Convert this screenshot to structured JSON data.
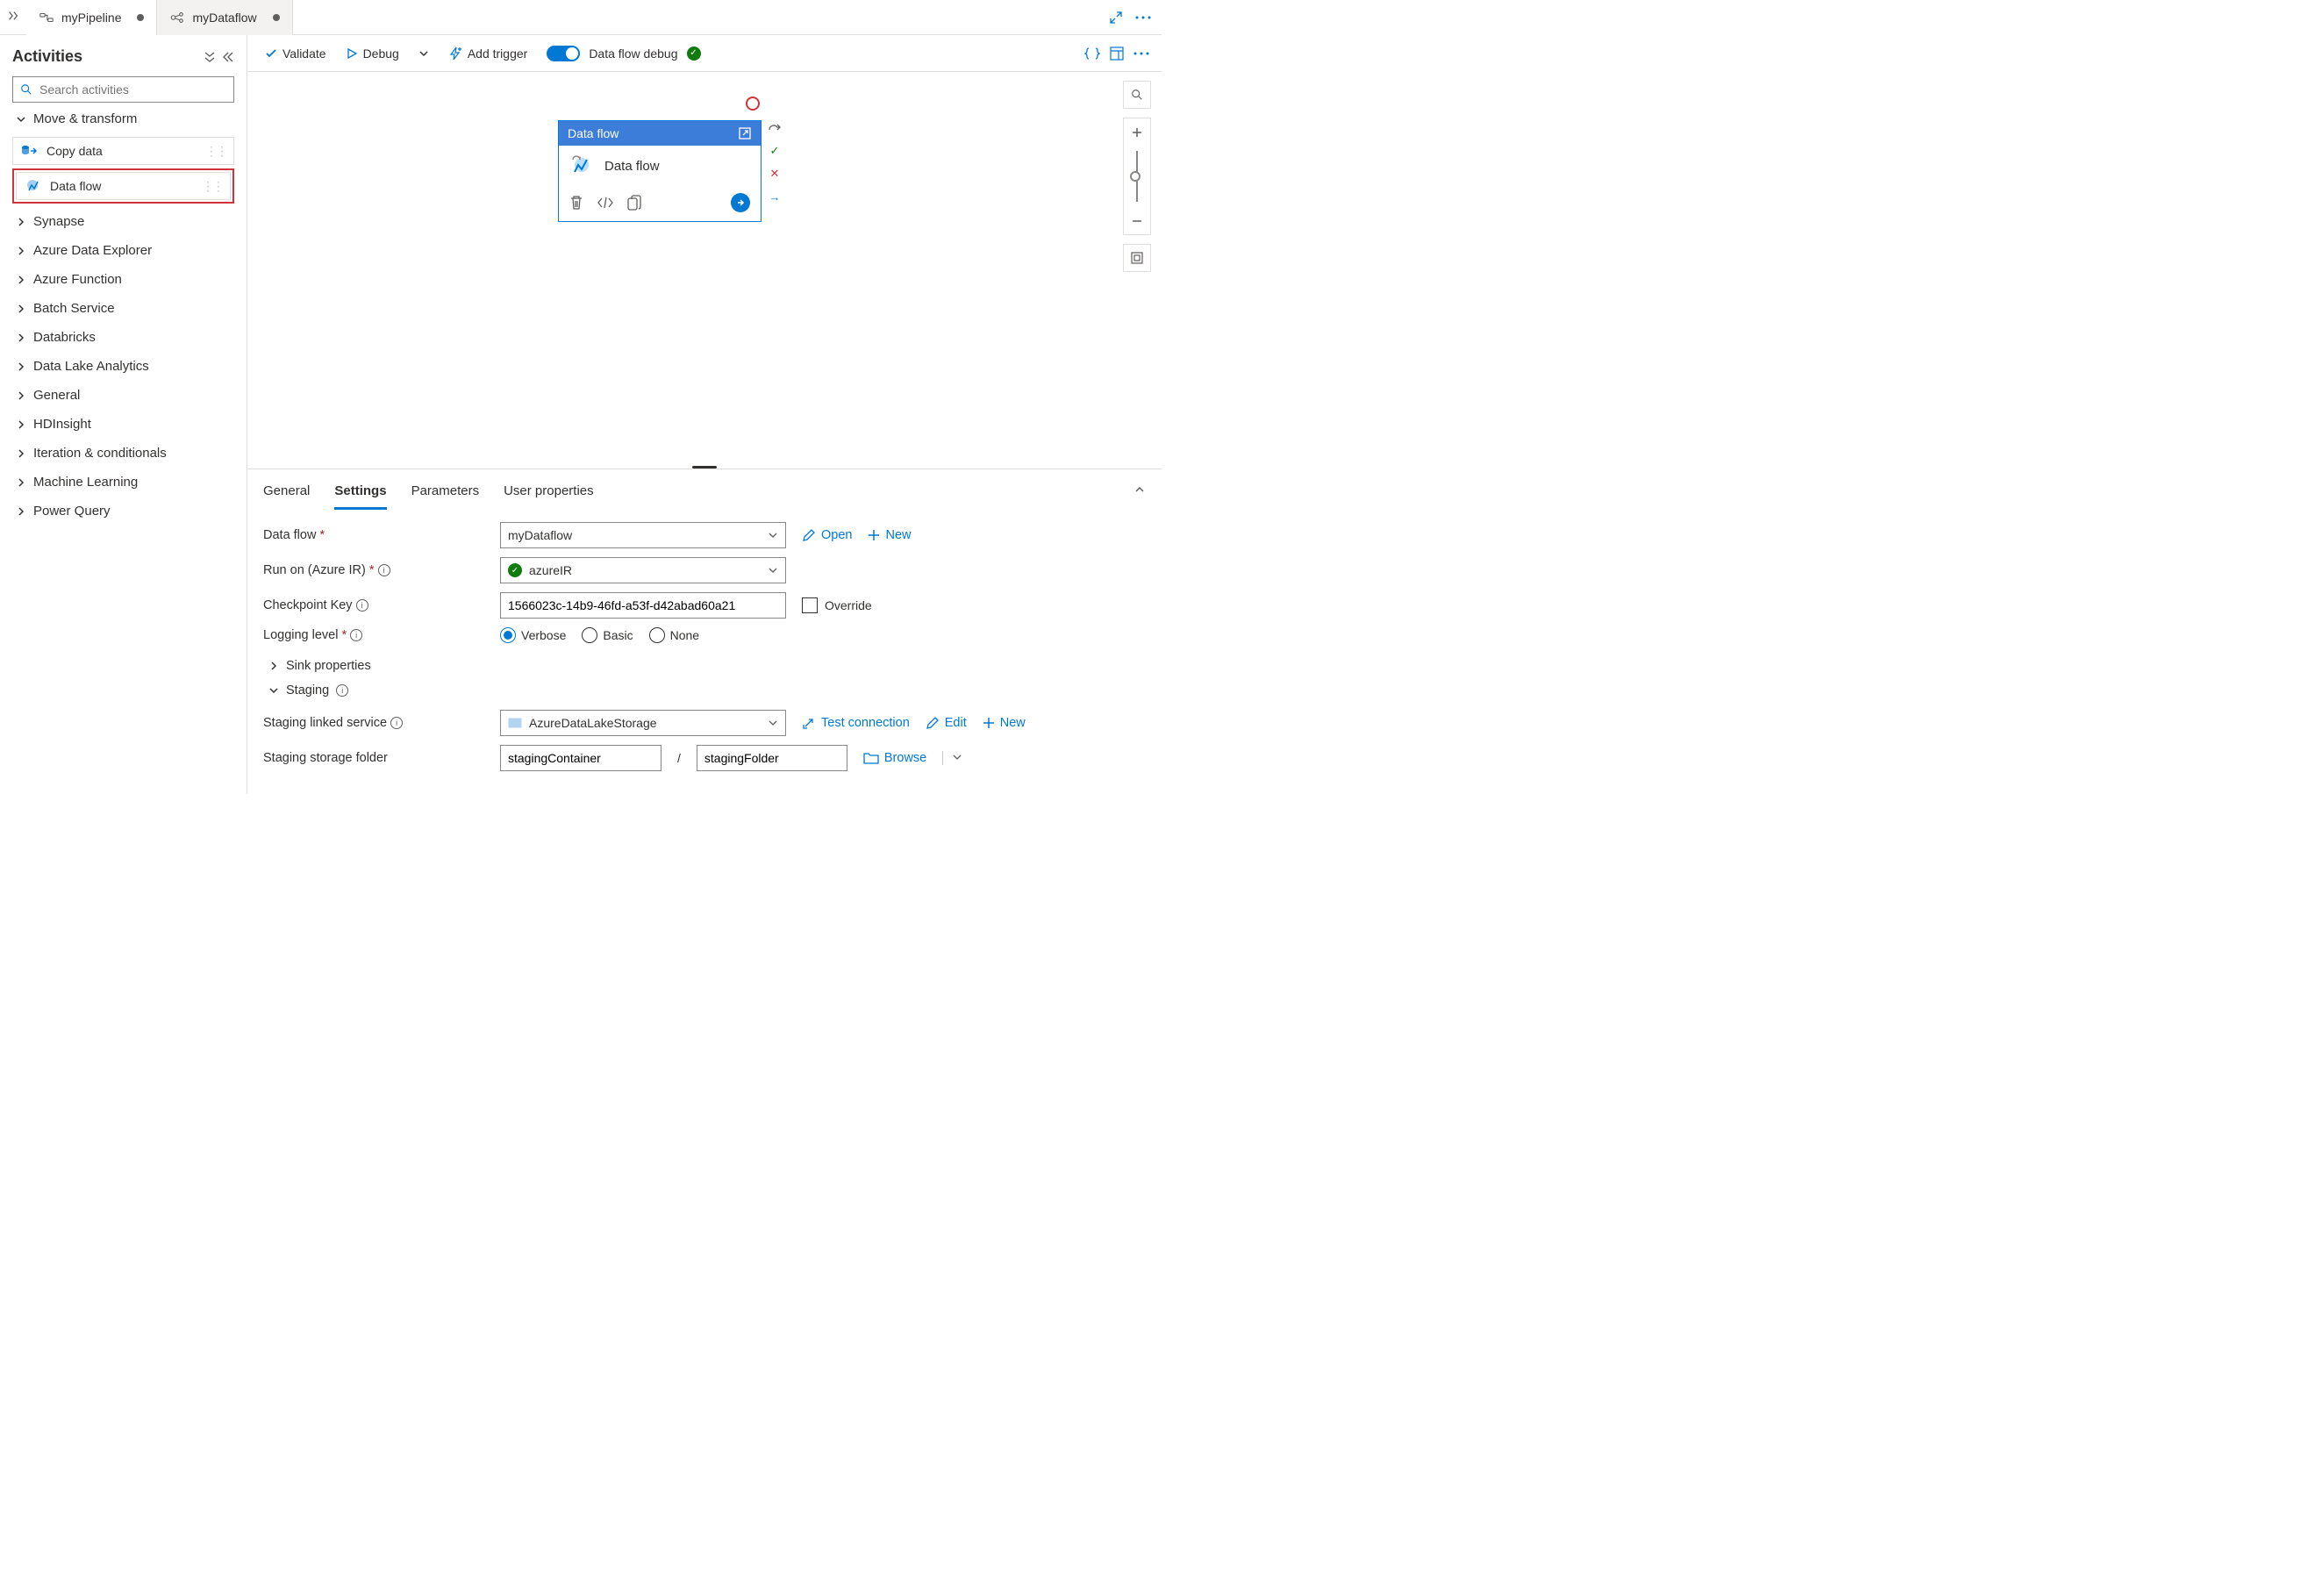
{
  "tabs": [
    {
      "icon": "pipeline",
      "label": "myPipeline",
      "dirty": true,
      "active": true
    },
    {
      "icon": "dataflow",
      "label": "myDataflow",
      "dirty": true,
      "active": false
    }
  ],
  "sidebar": {
    "title": "Activities",
    "search_placeholder": "Search activities",
    "move_transform": {
      "label": "Move & transform",
      "items": [
        "Copy data",
        "Data flow"
      ]
    },
    "categories": [
      "Synapse",
      "Azure Data Explorer",
      "Azure Function",
      "Batch Service",
      "Databricks",
      "Data Lake Analytics",
      "General",
      "HDInsight",
      "Iteration & conditionals",
      "Machine Learning",
      "Power Query"
    ]
  },
  "toolbar": {
    "validate": "Validate",
    "debug": "Debug",
    "add_trigger": "Add trigger",
    "dataflow_debug": "Data flow debug"
  },
  "node": {
    "header": "Data flow",
    "title": "Data flow"
  },
  "properties": {
    "tabs": [
      "General",
      "Settings",
      "Parameters",
      "User properties"
    ],
    "active_tab": "Settings",
    "data_flow_label": "Data flow",
    "data_flow_value": "myDataflow",
    "open": "Open",
    "new": "New",
    "run_on_label": "Run on (Azure IR)",
    "run_on_value": "azureIR",
    "checkpoint_label": "Checkpoint Key",
    "checkpoint_value": "1566023c-14b9-46fd-a53f-d42abad60a21",
    "override": "Override",
    "logging_label": "Logging level",
    "logging_options": [
      "Verbose",
      "Basic",
      "None"
    ],
    "logging_value": "Verbose",
    "sink_properties": "Sink properties",
    "staging": "Staging",
    "staging_linked_label": "Staging linked service",
    "staging_linked_value": "AzureDataLakeStorage",
    "test_connection": "Test connection",
    "edit": "Edit",
    "staging_folder_label": "Staging storage folder",
    "staging_container": "stagingContainer",
    "staging_folder": "stagingFolder",
    "browse": "Browse"
  }
}
